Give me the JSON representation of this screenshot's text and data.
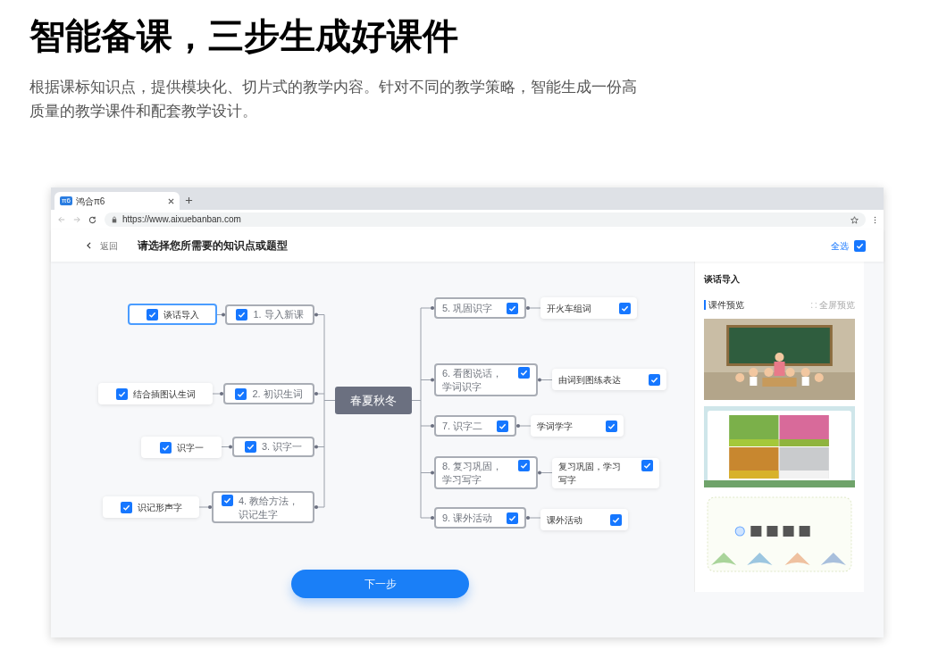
{
  "headline": "智能备课，三步生成好课件",
  "intro": "根据课标知识点，提供模块化、切片式的教学内容。针对不同的教学策略，智能生成一份高质量的教学课件和配套教学设计。",
  "browser": {
    "tab": {
      "title": "鸿合π6",
      "logo": "π6"
    },
    "url": "https://www.aixuebanban.com"
  },
  "header": {
    "back": "返回",
    "title": "请选择您所需要的知识点或题型",
    "select_all": {
      "label": "全选",
      "checked": true
    }
  },
  "mindmap": {
    "center": "春夏秋冬",
    "left": [
      {
        "label": "1. 导入新课",
        "checked": true,
        "child": {
          "label": "谈话导入",
          "checked": true,
          "selected": true
        }
      },
      {
        "label": "2. 初识生词",
        "checked": true,
        "child": {
          "label": "结合插图认生词",
          "checked": true,
          "selected": false
        }
      },
      {
        "label": "3. 识字一",
        "checked": true,
        "child": {
          "label": "识字一",
          "checked": true,
          "selected": false
        }
      },
      {
        "label": "4. 教给方法，识记生字",
        "checked": true,
        "child": {
          "label": "识记形声字",
          "checked": true,
          "selected": false
        }
      }
    ],
    "right": [
      {
        "label": "5. 巩固识字",
        "checked": true,
        "child": {
          "label": "开火车组词",
          "checked": true,
          "selected": false
        }
      },
      {
        "label": "6. 看图说话，学词识字",
        "checked": true,
        "child": {
          "label": "由词到图练表达",
          "checked": true,
          "selected": false
        }
      },
      {
        "label": "7. 识字二",
        "checked": true,
        "child": {
          "label": "学词学字",
          "checked": true,
          "selected": false
        }
      },
      {
        "label": "8. 复习巩固，学习写字",
        "checked": true,
        "child": {
          "label": "复习巩固，学习写字",
          "checked": true,
          "selected": false
        }
      },
      {
        "label": "9. 课外活动",
        "checked": true,
        "child": {
          "label": "课外活动",
          "checked": true,
          "selected": false
        }
      }
    ]
  },
  "next_button": "下一步",
  "panel": {
    "title": "谈话导入",
    "section": "课件预览",
    "fullscreen": "全屏预览"
  }
}
